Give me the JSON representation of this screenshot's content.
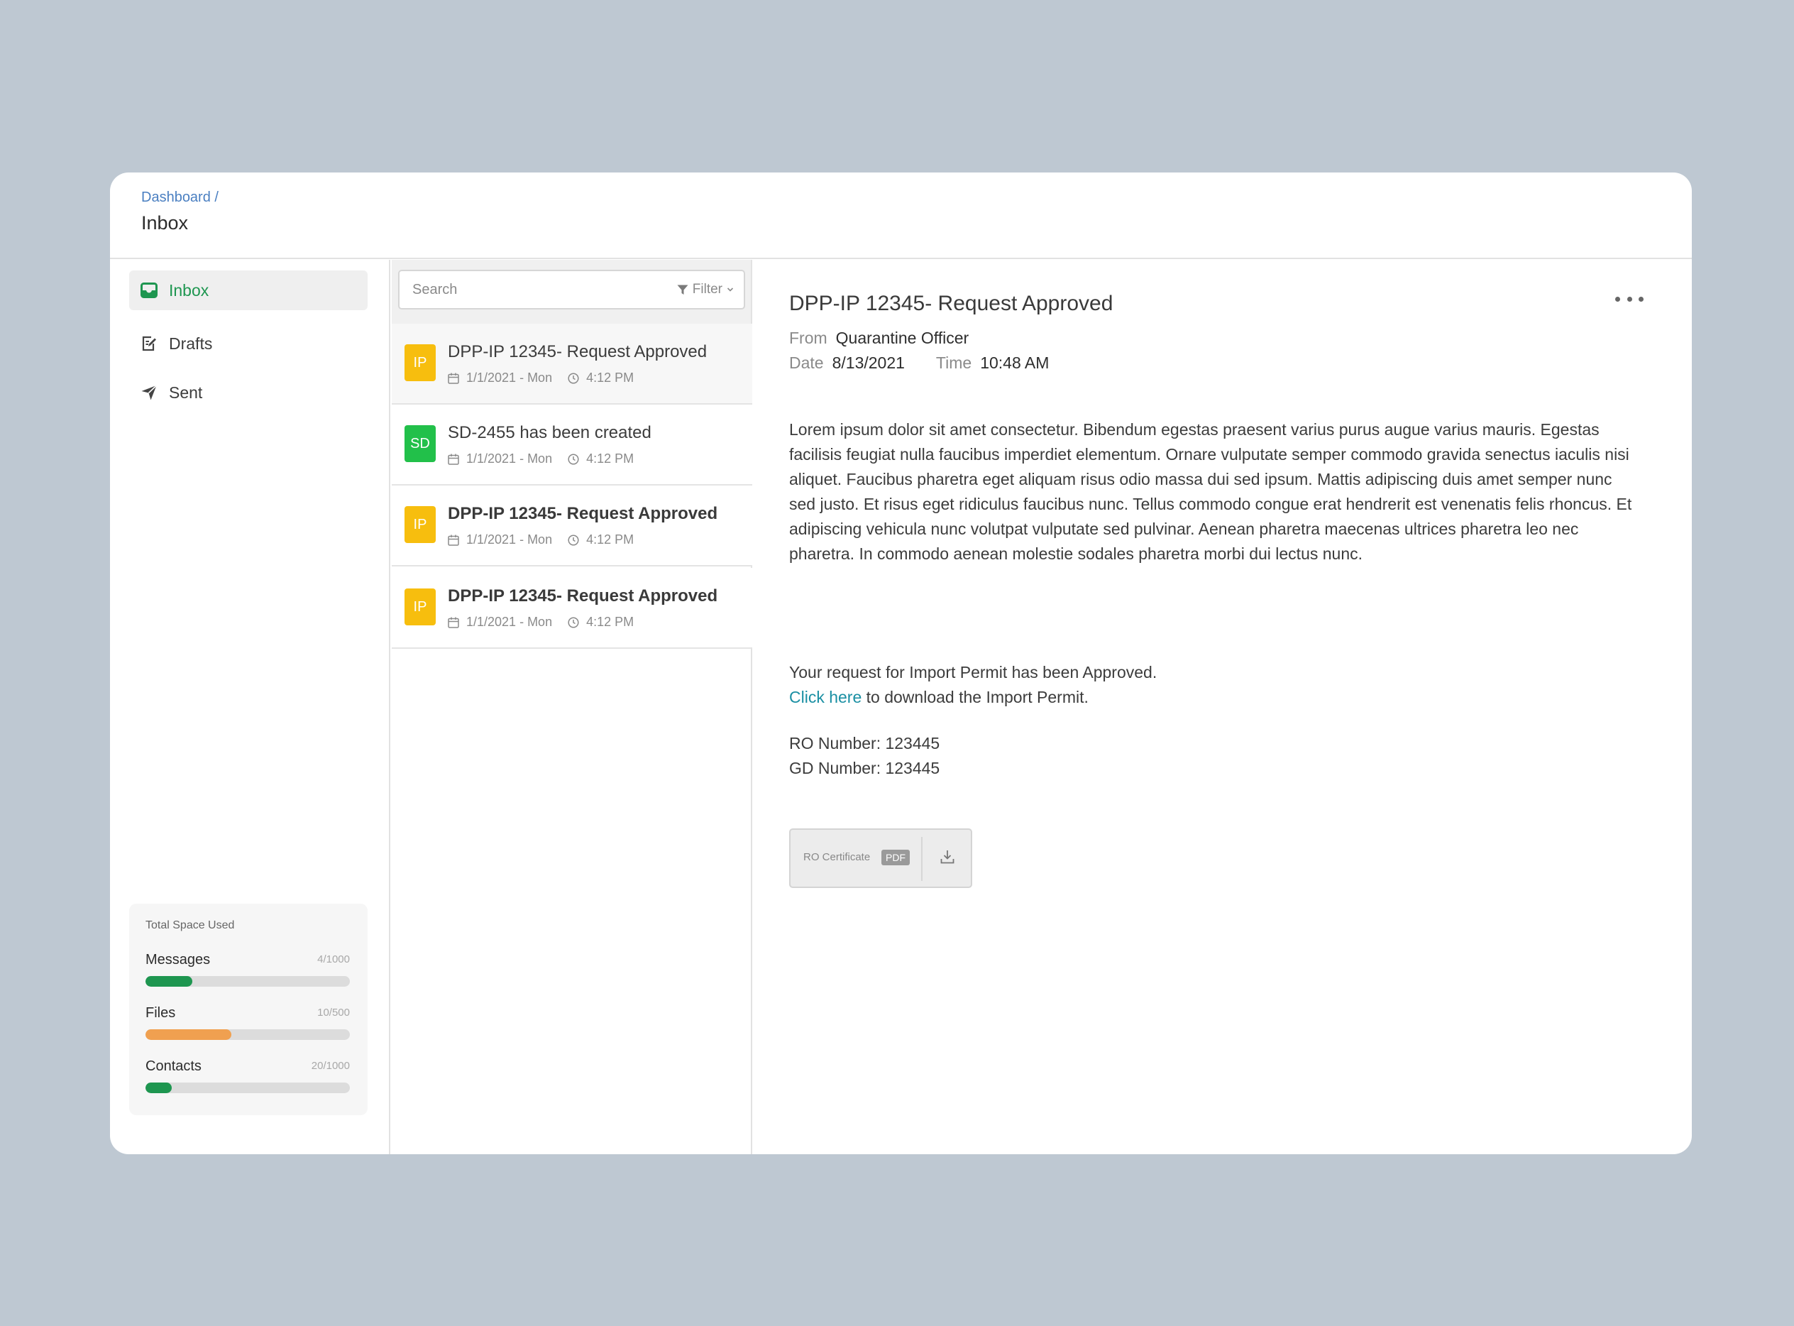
{
  "breadcrumb": {
    "parent": "Dashboard /",
    "current": "Inbox"
  },
  "sidebar": {
    "items": [
      {
        "label": "Inbox",
        "icon": "inbox-icon",
        "active": true
      },
      {
        "label": "Drafts",
        "icon": "drafts-icon",
        "active": false
      },
      {
        "label": "Sent",
        "icon": "send-icon",
        "active": false
      }
    ],
    "storage": {
      "title": "Total Space Used",
      "items": [
        {
          "label": "Messages",
          "count": "4/1000",
          "fraction": 0.23,
          "color": "#1e9650"
        },
        {
          "label": "Files",
          "count": "10/500",
          "fraction": 0.42,
          "color": "#f0a050"
        },
        {
          "label": "Contacts",
          "count": "20/1000",
          "fraction": 0.13,
          "color": "#1e9650"
        }
      ]
    }
  },
  "list": {
    "search_placeholder": "Search",
    "filter_label": "Filter",
    "messages": [
      {
        "avatar": "IP",
        "avatar_color": "#f7be0e",
        "subject": "DPP-IP 12345- Request Approved",
        "date": "1/1/2021 - Mon",
        "time": "4:12 PM",
        "selected": true,
        "unread": false
      },
      {
        "avatar": "SD",
        "avatar_color": "#22c04a",
        "subject": "SD-2455 has been created",
        "date": "1/1/2021 - Mon",
        "time": "4:12 PM",
        "selected": false,
        "unread": false
      },
      {
        "avatar": "IP",
        "avatar_color": "#f7be0e",
        "subject": "DPP-IP 12345- Request Approved",
        "date": "1/1/2021 - Mon",
        "time": "4:12 PM",
        "selected": false,
        "unread": true
      },
      {
        "avatar": "IP",
        "avatar_color": "#f7be0e",
        "subject": "DPP-IP 12345- Request Approved",
        "date": "1/1/2021 - Mon",
        "time": "4:12 PM",
        "selected": false,
        "unread": true
      }
    ]
  },
  "detail": {
    "subject": "DPP-IP 12345- Request Approved",
    "from_label": "From",
    "from_value": "Quarantine Officer",
    "date_label": "Date",
    "date_value": "8/13/2021",
    "time_label": "Time",
    "time_value": "10:48 AM",
    "body": "Lorem ipsum dolor sit amet consectetur. Bibendum egestas praesent varius purus augue varius mauris. Egestas facilisis feugiat nulla faucibus imperdiet elementum. Ornare vulputate semper commodo gravida senectus iaculis nisi aliquet. Faucibus pharetra eget aliquam risus odio massa dui sed ipsum. Mattis adipiscing duis amet semper nunc sed justo. Et risus eget ridiculus faucibus nunc. Tellus commodo congue erat hendrerit est venenatis felis rhoncus. Et adipiscing vehicula nunc volutpat vulputate sed pulvinar. Aenean pharetra maecenas ultrices pharetra leo nec pharetra. In commodo aenean molestie sodales pharetra morbi dui lectus nunc.",
    "approval_text": "Your request for Import Permit has been Approved.",
    "link_text": "Click here",
    "link_suffix": " to download the Import Permit.",
    "ro_number": "RO Number: 123445",
    "gd_number": "GD Number: 123445",
    "attachment": {
      "name": "RO Certificate",
      "type": "PDF"
    }
  },
  "colors": {
    "accent_green": "#1e9650",
    "link": "#1a8fa3",
    "crumb": "#4a7fc1"
  }
}
